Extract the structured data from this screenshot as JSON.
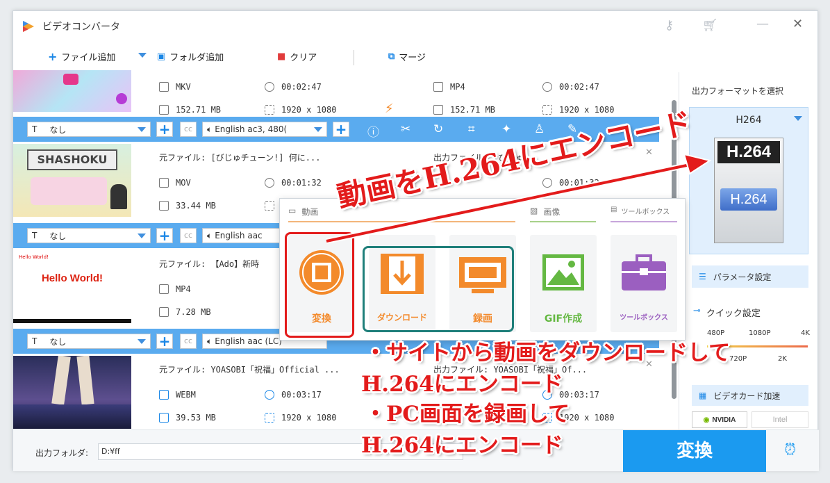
{
  "app": {
    "title": "ビデオコンバータ"
  },
  "toolbar": {
    "add_file": "ファイル追加",
    "add_folder": "フォルダ追加",
    "clear": "クリア",
    "merge": "マージ"
  },
  "items": [
    {
      "src_format": "MKV",
      "src_duration": "00:02:47",
      "src_size": "152.71 MB",
      "src_res": "1920 x 1080",
      "out_format": "MP4",
      "out_duration": "00:02:47",
      "out_size": "152.71 MB",
      "out_res": "1920 x 1080",
      "subtitle": "なし",
      "audio": "English ac3, 480("
    },
    {
      "src_name": "元ファイル: [びじゅチューン!] 何に...",
      "out_name": "出力ファイル: [びじゅ",
      "src_format": "MOV",
      "src_duration": "00:01:32",
      "src_size": "33.44 MB",
      "out_duration": "00:01:32",
      "subtitle": "なし",
      "audio": "English aac"
    },
    {
      "src_name": "元ファイル: 【Ado】新時",
      "thumb_text": "Hello World!",
      "thumb_small": "Hello World!",
      "src_format": "MP4",
      "src_size": "7.28 MB",
      "subtitle": "なし",
      "audio": "English aac (LC)"
    },
    {
      "src_name": "元ファイル: YOASOBI「祝福」Official ...",
      "out_name": "出力ファイル: YOASOBI「祝福」Of...",
      "src_format": "WEBM",
      "src_duration": "00:03:17",
      "src_size": "39.53 MB",
      "src_res": "1920 x 1080",
      "out_duration": "00:03:17",
      "out_res": "1920 x 1080"
    }
  ],
  "popup": {
    "section_video": "動画",
    "section_image": "画像",
    "section_toolbox": "ツールボックス",
    "convert": "変換",
    "download": "ダウンロード",
    "record": "録画",
    "gif": "GIF作成",
    "toolbox": "ツールボックス"
  },
  "right": {
    "format_title": "出力フォーマットを選択",
    "format": "H264",
    "badge_top": "H.264",
    "badge_bottom": "H.264",
    "param": "パラメータ設定",
    "quick": "クイック設定",
    "q_top": [
      "480P",
      "1080P",
      "4K"
    ],
    "q_bottom": [
      "720P",
      "2K"
    ],
    "gpu": "ビデオカード加速",
    "nvidia": "NVIDIA",
    "intel": "Intel"
  },
  "bottom": {
    "out_folder_label": "出力フォルダ:",
    "out_folder_value": "D:¥ff",
    "convert": "変換"
  },
  "annotations": {
    "headline": "動画をH.264にエンコード",
    "line1": "・サイトから動画をダウンロードして",
    "line2": "H.264にエンコード",
    "line3": "・PC画面を録画して",
    "line4": "H.264にエンコード"
  },
  "colors": {
    "accent": "#1b9af0",
    "orange": "#f38a2b",
    "red": "#e31b1b",
    "teal": "#1f7f7a"
  }
}
